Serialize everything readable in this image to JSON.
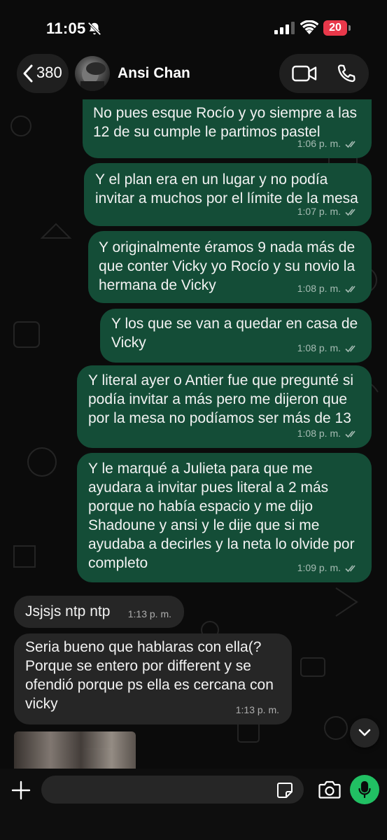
{
  "status_bar": {
    "time": "11:05",
    "icons": [
      "bell-slash-icon",
      "signal-icon",
      "wifi-icon",
      "battery-icon"
    ],
    "battery_level": "20",
    "battery_color": "#e8384a"
  },
  "header": {
    "back_count": "380",
    "contact_name": "Ansi Chan",
    "icons": [
      "chevron-left-icon",
      "video-call-icon",
      "phone-call-icon"
    ]
  },
  "messages": [
    {
      "direction": "outgoing",
      "text": "No pues esque Rocío y yo siempre a las\n12 de su cumple le partimos pastel",
      "time": "1:06 p. m.",
      "read": true
    },
    {
      "direction": "outgoing",
      "text": "Y el plan era en un lugar y no podía\ninvitar a muchos por el límite de la mesa",
      "time": "1:07 p. m.",
      "read": true
    },
    {
      "direction": "outgoing",
      "text": "Y originalmente éramos 9 nada más de\nque conter Vicky yo Rocío y su novio la\nhermana de Vicky",
      "time": "1:08 p. m.",
      "read": true
    },
    {
      "direction": "outgoing",
      "text": "Y los que se van a quedar en casa de\nVicky",
      "time": "1:08 p. m.",
      "read": true
    },
    {
      "direction": "outgoing",
      "text": "Y literal ayer o Antier fue que pregunté si\npodía invitar a más pero me dijeron que\npor la mesa no podíamos ser más de 13",
      "time": "1:08 p. m.",
      "read": true
    },
    {
      "direction": "outgoing",
      "text": "Y le marqué a Julieta para que me\nayudara a invitar pues literal a 2 más\nporque no había espacio y me dijo\nShadoune y ansi y le dije que si me\nayudaba a decirles y la neta lo olvide por\ncompleto",
      "time": "1:09 p. m.",
      "read": true
    },
    {
      "direction": "incoming",
      "text": "Jsjsjs ntp ntp",
      "time": "1:13 p. m."
    },
    {
      "direction": "incoming",
      "text": "Seria bueno que hablaras con ella(?\nPorque se entero por different y se\nofendió porque ps ella es cercana con\nvicky",
      "time": "1:13 p. m."
    }
  ],
  "composer": {
    "placeholder": "",
    "icons": [
      "plus-icon",
      "sticker-icon",
      "camera-icon",
      "microphone-icon"
    ]
  },
  "colors": {
    "outgoing_bubble": "#144d37",
    "incoming_bubble": "#262626",
    "accent": "#21c063",
    "background": "#0b0b0b"
  }
}
